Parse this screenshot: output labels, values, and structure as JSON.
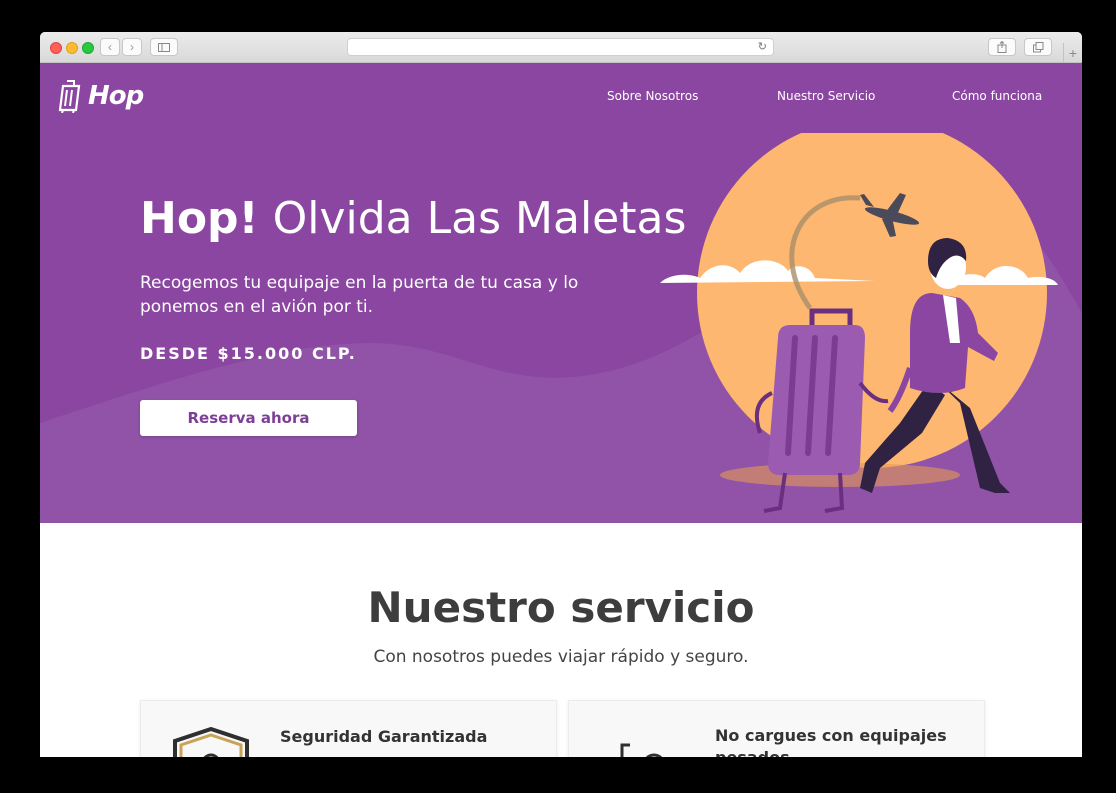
{
  "browser": {
    "address_value": "",
    "reload_glyph": "↻",
    "back_glyph": "‹",
    "forward_glyph": "›",
    "new_tab_glyph": "+"
  },
  "header": {
    "logo_text": "Hop",
    "nav": [
      {
        "label": "Sobre Nosotros"
      },
      {
        "label": "Nuestro Servicio"
      },
      {
        "label": "Cómo funciona"
      }
    ]
  },
  "hero": {
    "title_bold": "Hop!",
    "title_light": "Olvida Las Maletas",
    "subtitle": "Recogemos tu equipaje en la puerta de tu casa y lo ponemos en el avión por ti.",
    "price": "DESDE $15.000 CLP.",
    "cta_label": "Reserva ahora"
  },
  "service": {
    "title": "Nuestro servicio",
    "subtitle": "Con nosotros puedes viajar rápido y seguro.",
    "cards": [
      {
        "title": "Seguridad Garantizada",
        "icon": "shield-lock-icon"
      },
      {
        "title": "No cargues con equipajes pesados",
        "icon": "luggage-icon"
      }
    ]
  },
  "colors": {
    "brand_purple": "#8a46a0",
    "sun_orange": "#fdb770",
    "cta_text": "#7d3f96"
  }
}
